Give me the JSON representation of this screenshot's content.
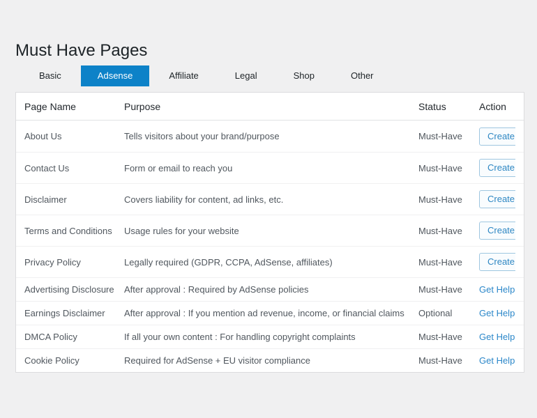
{
  "page": {
    "title": "Must Have Pages"
  },
  "colors": {
    "page_background": "#f0f0f1",
    "active_tab_background": "#0d82c8",
    "active_tab_text": "#ffffff",
    "link_blue": "#2b87c9",
    "create_button_border": "#9ec6e0",
    "card_border": "#dcdcde"
  },
  "tabs": [
    {
      "label": "Basic",
      "active": false
    },
    {
      "label": "Adsense",
      "active": true
    },
    {
      "label": "Affiliate",
      "active": false
    },
    {
      "label": "Legal",
      "active": false
    },
    {
      "label": "Shop",
      "active": false
    },
    {
      "label": "Other",
      "active": false
    }
  ],
  "table": {
    "columns": {
      "page_name": "Page Name",
      "purpose": "Purpose",
      "status": "Status",
      "action": "Action"
    },
    "rows": [
      {
        "page_name": "About Us",
        "purpose": "Tells visitors about your brand/purpose",
        "status": "Must-Have",
        "action": "Create",
        "action_type": "button"
      },
      {
        "page_name": "Contact Us",
        "purpose": "Form or email to reach you",
        "status": "Must-Have",
        "action": "Create",
        "action_type": "button"
      },
      {
        "page_name": "Disclaimer",
        "purpose": "Covers liability for content, ad links, etc.",
        "status": "Must-Have",
        "action": "Create",
        "action_type": "button"
      },
      {
        "page_name": "Terms and Conditions",
        "purpose": "Usage rules for your website",
        "status": "Must-Have",
        "action": "Create",
        "action_type": "button"
      },
      {
        "page_name": "Privacy Policy",
        "purpose": "Legally required (GDPR, CCPA, AdSense, affiliates)",
        "status": "Must-Have",
        "action": "Create",
        "action_type": "button"
      },
      {
        "page_name": "Advertising Disclosure",
        "purpose": "After approval : Required by AdSense policies",
        "status": "Must-Have",
        "action": "Get Help",
        "action_type": "link"
      },
      {
        "page_name": "Earnings Disclaimer",
        "purpose": "After approval : If you mention ad revenue, income, or financial claims",
        "status": "Optional",
        "action": "Get Help",
        "action_type": "link"
      },
      {
        "page_name": "DMCA Policy",
        "purpose": "If all your own content : For handling copyright complaints",
        "status": "Must-Have",
        "action": "Get Help",
        "action_type": "link"
      },
      {
        "page_name": "Cookie Policy",
        "purpose": "Required for AdSense + EU visitor compliance",
        "status": "Must-Have",
        "action": "Get Help",
        "action_type": "link"
      }
    ]
  }
}
